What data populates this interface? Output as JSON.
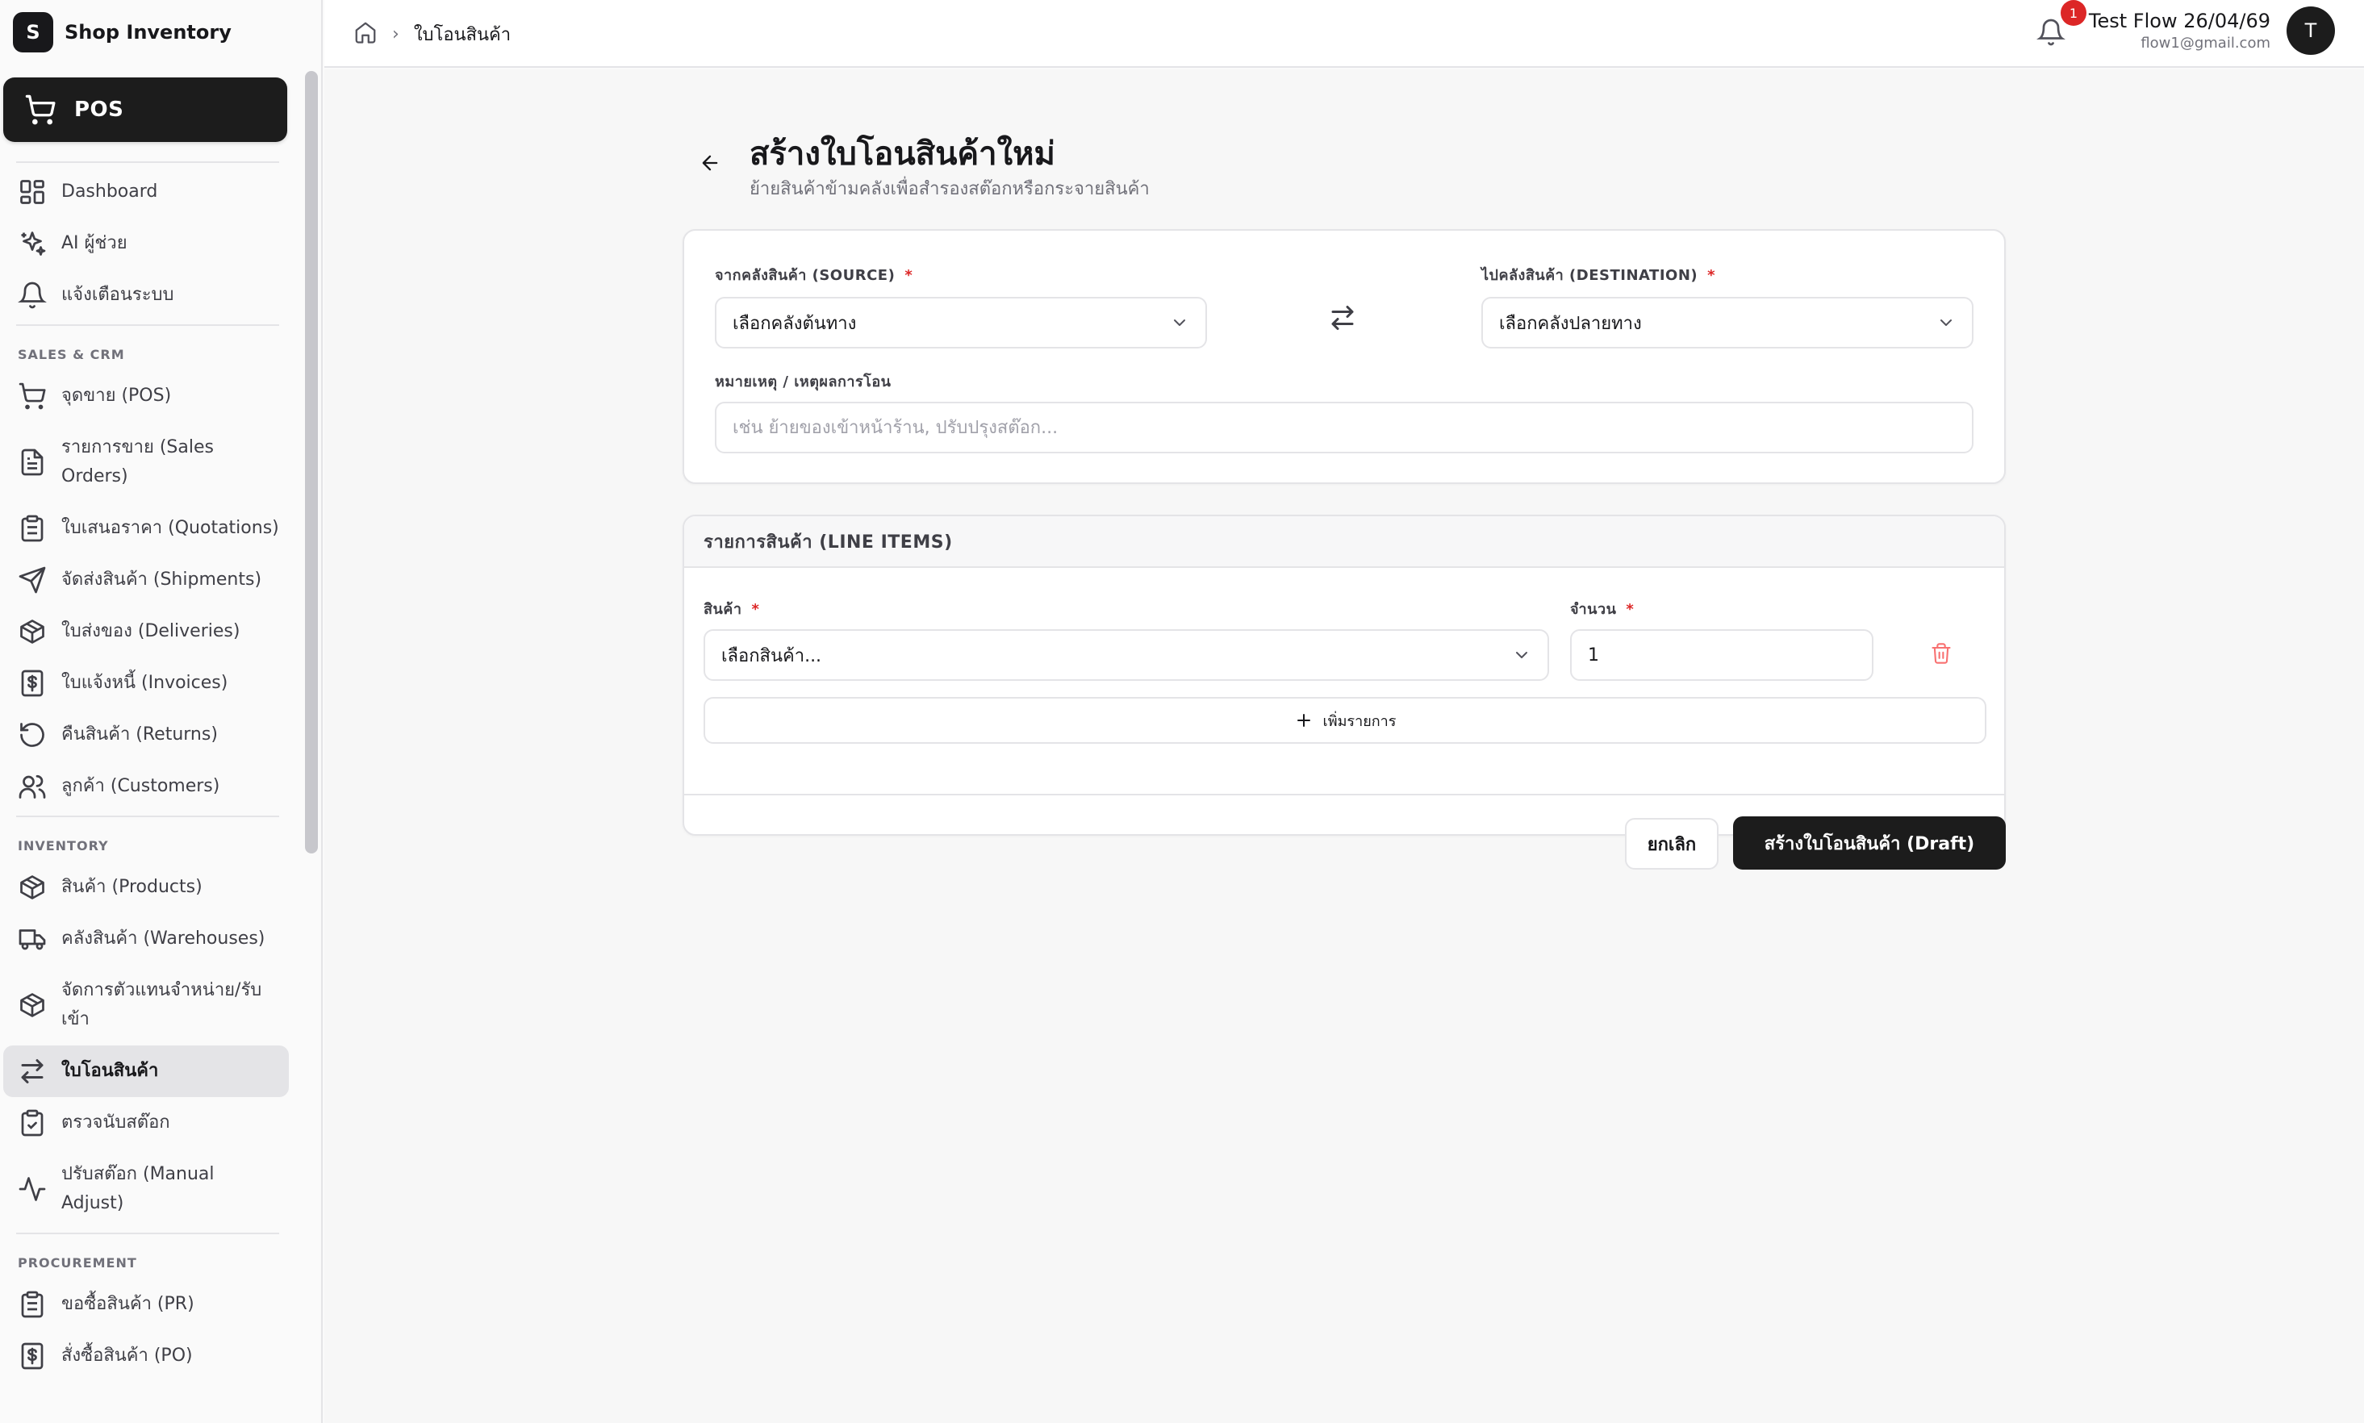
{
  "brand": {
    "logo_letter": "S",
    "name": "Shop Inventory"
  },
  "pos_button": {
    "label": "POS",
    "icon": "cart-icon"
  },
  "sidebar": {
    "top_items": [
      {
        "label": "Dashboard",
        "icon": "dashboard-icon"
      },
      {
        "label": "AI ผู้ช่วย",
        "icon": "sparkles-icon"
      },
      {
        "label": "แจ้งเตือนระบบ",
        "icon": "bell-icon"
      }
    ],
    "sections": [
      {
        "title": "SALES & CRM",
        "items": [
          {
            "label": "จุดขาย (POS)",
            "icon": "cart-icon"
          },
          {
            "label": "รายการขาย (Sales Orders)",
            "icon": "document-icon"
          },
          {
            "label": "ใบเสนอราคา (Quotations)",
            "icon": "clipboard-icon"
          },
          {
            "label": "จัดส่งสินค้า (Shipments)",
            "icon": "send-icon"
          },
          {
            "label": "ใบส่งของ (Deliveries)",
            "icon": "package-icon"
          },
          {
            "label": "ใบแจ้งหนี้ (Invoices)",
            "icon": "dollar-receipt-icon"
          },
          {
            "label": "คืนสินค้า (Returns)",
            "icon": "rotate-ccw-icon"
          },
          {
            "label": "ลูกค้า (Customers)",
            "icon": "users-icon"
          }
        ]
      },
      {
        "title": "INVENTORY",
        "items": [
          {
            "label": "สินค้า (Products)",
            "icon": "package-icon"
          },
          {
            "label": "คลังสินค้า (Warehouses)",
            "icon": "truck-icon"
          },
          {
            "label": "จัดการตัวแทนจำหน่าย/รับเข้า",
            "icon": "package-icon"
          },
          {
            "label": "ใบโอนสินค้า",
            "icon": "swap-icon",
            "active": true
          },
          {
            "label": "ตรวจนับสต๊อก",
            "icon": "clipboard-check-icon"
          },
          {
            "label": "ปรับสต๊อก (Manual Adjust)",
            "icon": "activity-icon"
          }
        ]
      },
      {
        "title": "PROCUREMENT",
        "items": [
          {
            "label": "ขอซื้อสินค้า (PR)",
            "icon": "clipboard-icon"
          },
          {
            "label": "สั่งซื้อสินค้า (PO)",
            "icon": "dollar-receipt-icon"
          }
        ]
      }
    ]
  },
  "header": {
    "breadcrumb_current": "ใบโอนสินค้า",
    "breadcrumb_separator": "›",
    "notification_count": "1",
    "user_name": "Test Flow 26/04/69",
    "user_email": "flow1@gmail.com",
    "avatar_letter": "T"
  },
  "page": {
    "title": "สร้างใบโอนสินค้าใหม่",
    "subtitle": "ย้ายสินค้าข้ามคลังเพื่อสำรองสต๊อกหรือกระจายสินค้า"
  },
  "form": {
    "source_label": "จากคลังสินค้า (SOURCE)",
    "source_value": "เลือกคลังต้นทาง",
    "destination_label": "ไปคลังสินค้า (DESTINATION)",
    "destination_value": "เลือกคลังปลายทาง",
    "note_label": "หมายเหตุ / เหตุผลการโอน",
    "note_placeholder": "เช่น ย้ายของเข้าหน้าร้าน, ปรับปรุงสต๊อก...",
    "required_mark": "*"
  },
  "line_items": {
    "title": "รายการสินค้า (LINE ITEMS)",
    "product_label": "สินค้า",
    "product_value": "เลือกสินค้า...",
    "qty_label": "จำนวน",
    "qty_value": "1",
    "add_label": "เพิ่มรายการ"
  },
  "actions": {
    "cancel_label": "ยกเลิก",
    "submit_label": "สร้างใบโอนสินค้า (Draft)"
  },
  "colors": {
    "primary": "#1c1c1c",
    "required": "#dc2626",
    "delete": "#f87171",
    "badge": "#dc2626"
  }
}
